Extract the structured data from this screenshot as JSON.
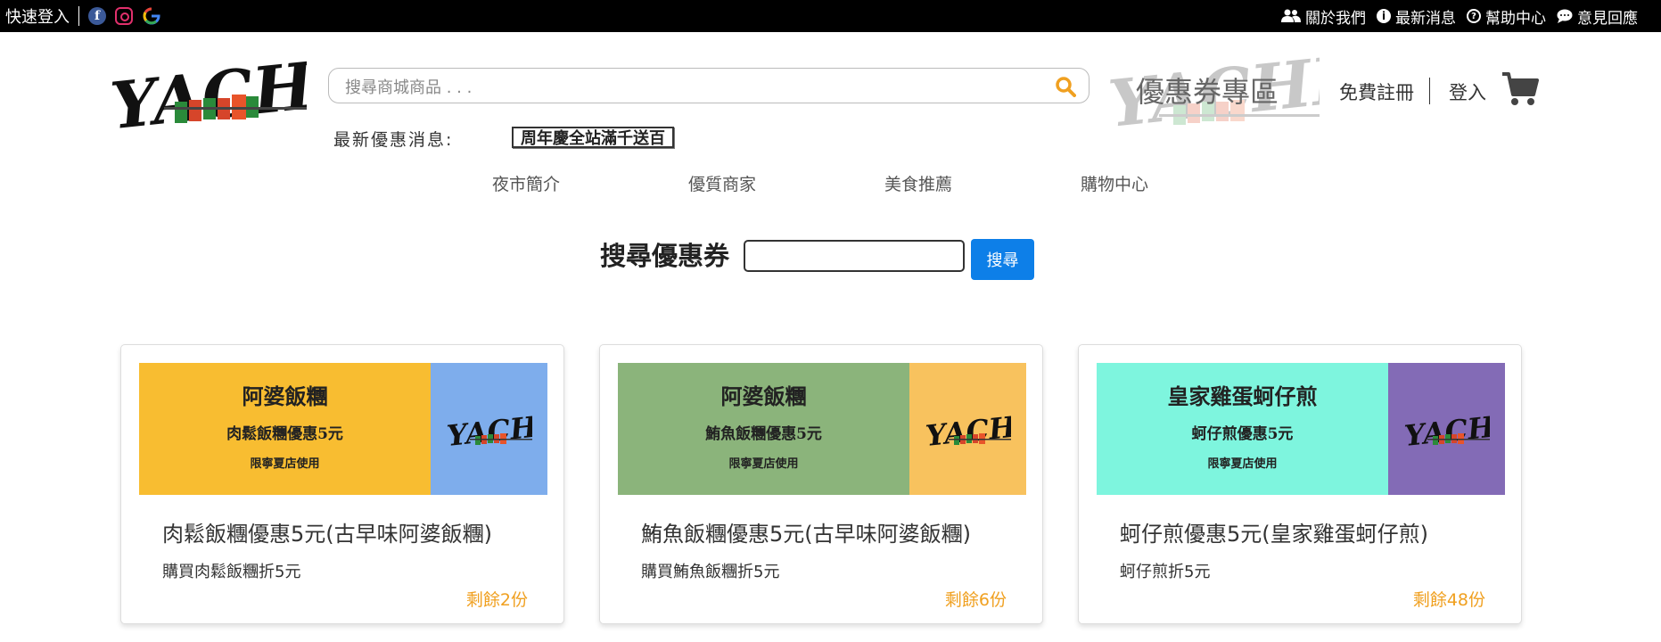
{
  "topbar": {
    "quick_login": "快速登入",
    "links": [
      {
        "label": "關於我們",
        "icon": "users-icon"
      },
      {
        "label": "最新消息",
        "icon": "info-icon"
      },
      {
        "label": "幫助中心",
        "icon": "help-icon"
      },
      {
        "label": "意見回應",
        "icon": "chat-icon"
      }
    ]
  },
  "header": {
    "logo_text": "YACHI",
    "search_placeholder": "搜尋商城商品 . . .",
    "coupon_zone": "優惠券專區",
    "register": "免費註冊",
    "login": "登入",
    "news_label": "最新優惠消息:",
    "news_text": "周年慶全站滿千送百"
  },
  "nav": [
    "夜市簡介",
    "優質商家",
    "美食推薦",
    "購物中心"
  ],
  "coupon_search": {
    "label": "搜尋優惠券",
    "button": "搜尋"
  },
  "coupons": [
    {
      "banner_store": "阿婆飯糰",
      "banner_offer": "肉鬆飯糰優惠5元",
      "banner_note": "限寧夏店使用",
      "left_color": "#f8bd31",
      "right_color": "#7eadec",
      "title": "肉鬆飯糰優惠5元(古早味阿婆飯糰)",
      "desc": "購買肉鬆飯糰折5元",
      "remain": "剩餘2份"
    },
    {
      "banner_store": "阿婆飯糰",
      "banner_offer": "鮪魚飯糰優惠5元",
      "banner_note": "限寧夏店使用",
      "left_color": "#8bb47b",
      "right_color": "#f8c25e",
      "title": "鮪魚飯糰優惠5元(古早味阿婆飯糰)",
      "desc": "購買鮪魚飯糰折5元",
      "remain": "剩餘6份"
    },
    {
      "banner_store": "皇家雞蛋蚵仔煎",
      "banner_offer": "蚵仔煎優惠5元",
      "banner_note": "限寧夏店使用",
      "left_color": "#7ef5de",
      "right_color": "#836bb6",
      "title": "蚵仔煎優惠5元(皇家雞蛋蚵仔煎)",
      "desc": "蚵仔煎折5元",
      "remain": "剩餘48份"
    }
  ],
  "colors": {
    "primary_button": "#0d7fe8",
    "remain_text": "#f0a020",
    "search_icon": "#f0a020"
  }
}
